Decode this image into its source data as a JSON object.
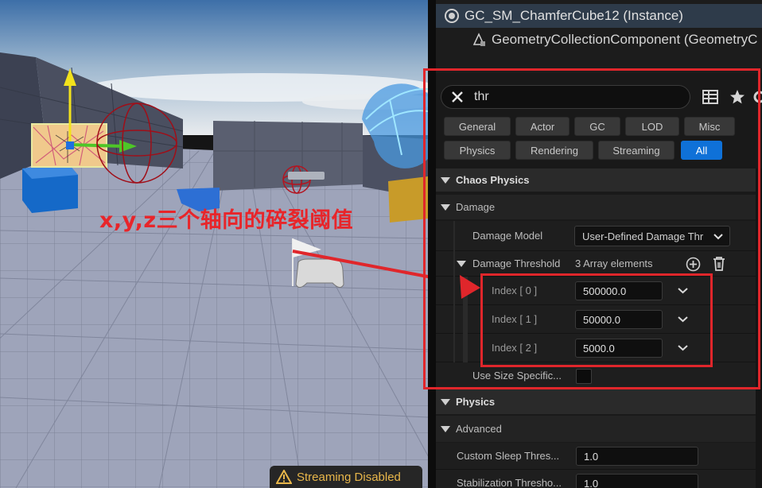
{
  "viewport": {
    "annotation": "x,y,z三个轴向的碎裂阈值",
    "streaming_label": "Streaming Disabled"
  },
  "outliner": {
    "items": [
      {
        "label": "GC_SM_ChamferCube12 (Instance)",
        "icon": "actor-icon"
      },
      {
        "label": "GeometryCollectionComponent (GeometryC",
        "icon": "geometry-collection-icon"
      }
    ]
  },
  "details": {
    "search_value": "thr",
    "filter_tabs": [
      "General",
      "Actor",
      "GC",
      "LOD",
      "Misc",
      "Physics",
      "Rendering",
      "Streaming",
      "All"
    ],
    "active_tab": "All",
    "sections": {
      "chaos_physics": "Chaos Physics",
      "damage": "Damage",
      "physics": "Physics",
      "advanced": "Advanced"
    },
    "damage_model": {
      "label": "Damage Model",
      "value": "User-Defined Damage Thr"
    },
    "damage_threshold": {
      "label": "Damage Threshold",
      "summary": "3 Array elements"
    },
    "threshold_elements": [
      {
        "index": "Index [ 0 ]",
        "value": "500000.0"
      },
      {
        "index": "Index [ 1 ]",
        "value": "50000.0"
      },
      {
        "index": "Index [ 2 ]",
        "value": "5000.0"
      }
    ],
    "use_size_specific": {
      "label": "Use Size Specific...",
      "checked": false
    },
    "custom_sleep": {
      "label": "Custom Sleep Thres...",
      "value": "1.0"
    },
    "stabilization": {
      "label": "Stabilization Thresho...",
      "value": "1.0"
    }
  },
  "colors": {
    "annotation_red": "#e0262b",
    "active_tab": "#0f71d8",
    "streaming_warning": "#e8b64a"
  }
}
